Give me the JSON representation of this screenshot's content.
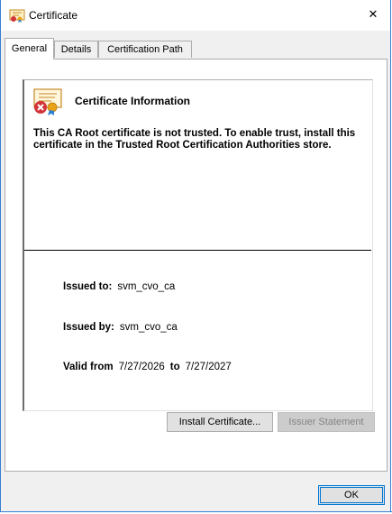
{
  "window": {
    "title": "Certificate",
    "title_icon": "certificate-icon",
    "close_glyph": "✕"
  },
  "tabs": [
    {
      "label": "General",
      "active": true
    },
    {
      "label": "Details",
      "active": false
    },
    {
      "label": "Certification Path",
      "active": false
    }
  ],
  "info": {
    "title": "Certificate Information",
    "message": "This CA Root certificate is not trusted. To enable trust, install this certificate in the Trusted Root Certification Authorities store.",
    "icon": "certificate-error-icon"
  },
  "fields": {
    "issued_to_label": "Issued to:",
    "issued_to_value": "svm_cvo_ca",
    "issued_by_label": "Issued by:",
    "issued_by_value": "svm_cvo_ca",
    "valid_from_label": "Valid from",
    "valid_from_value": "7/27/2026",
    "valid_to_label": "to",
    "valid_to_value": "7/27/2027"
  },
  "buttons": {
    "install": "Install Certificate...",
    "issuer_statement": "Issuer Statement",
    "ok": "OK"
  },
  "colors": {
    "accent": "#0078d7",
    "error_red": "#d13438",
    "window_border": "#3b7fd0"
  }
}
